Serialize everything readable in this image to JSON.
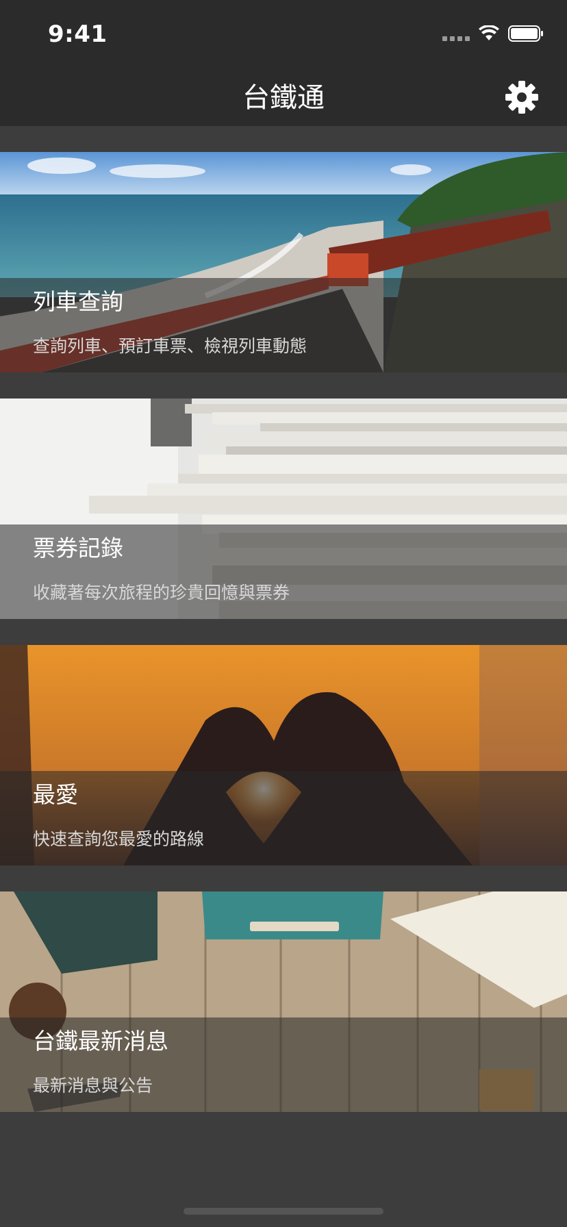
{
  "status_bar": {
    "time": "9:41"
  },
  "nav": {
    "title": "台鐵通",
    "settings_icon": "gear-icon"
  },
  "cards": [
    {
      "title": "列車查詢",
      "subtitle": "查詢列車、預訂車票、檢視列車動態"
    },
    {
      "title": "票券記錄",
      "subtitle": "收藏著每次旅程的珍貴回憶與票券"
    },
    {
      "title": "最愛",
      "subtitle": "快速查詢您最愛的路線"
    },
    {
      "title": "台鐵最新消息",
      "subtitle": "最新消息與公告"
    }
  ],
  "colors": {
    "background": "#3d3d3d",
    "bar": "#2b2b2b",
    "overlay": "rgba(40,40,40,0.55)"
  }
}
